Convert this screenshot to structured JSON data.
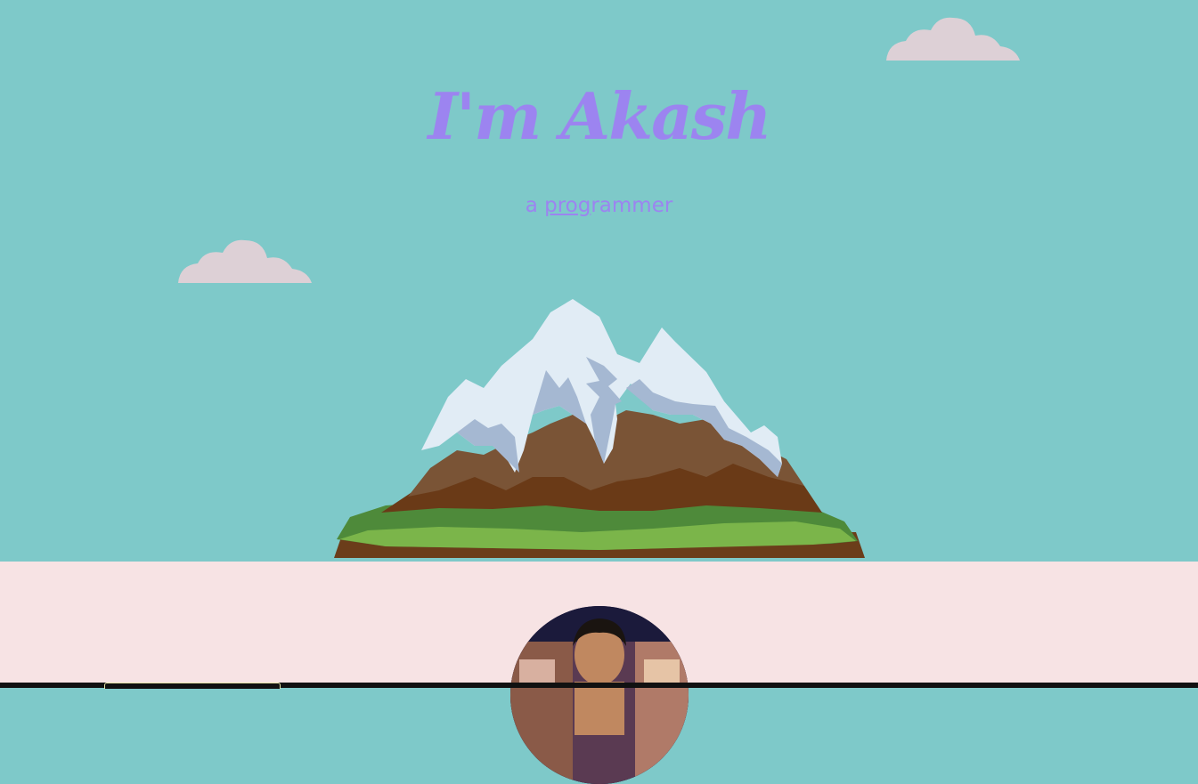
{
  "hero": {
    "title": "I'm Akash",
    "subtitle_prefix": "a ",
    "subtitle_link_underlined": "prog",
    "subtitle_link_rest": "rammer"
  },
  "colors": {
    "sky": "#7ec9c9",
    "ground": "#f7e3e4",
    "accent": "#9c84f0",
    "cloud": "#ddd0d6"
  },
  "icons": {
    "cloud": "cloud-icon",
    "mountain": "mountain-illustration",
    "avatar": "profile-photo"
  }
}
